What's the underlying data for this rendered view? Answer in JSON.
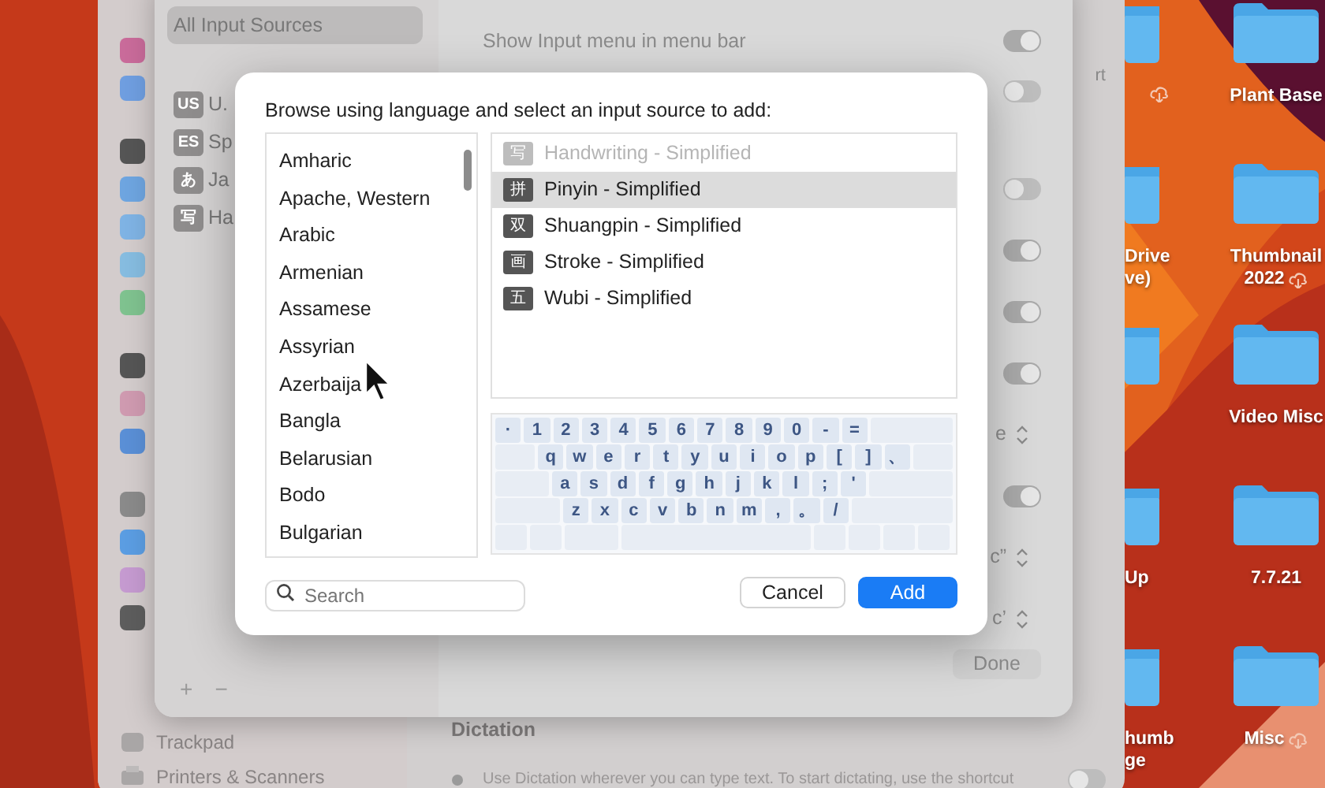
{
  "desktop": {
    "folder_columns": [
      {
        "folders": [
          {
            "cloud": true
          },
          {
            "label_lines": [
              "Drive",
              "ve)"
            ],
            "cloud": false
          },
          {
            "cloud": false
          },
          {
            "label_lines": [
              "Up"
            ],
            "cloud": false
          },
          {
            "label_lines": [
              "humb",
              "ge"
            ],
            "cloud": false
          }
        ]
      },
      {
        "folders": [
          {
            "label_lines": [
              "Plant Base"
            ],
            "cloud": false
          },
          {
            "label_lines": [
              "Thumbnail",
              "2022"
            ],
            "cloud": true
          },
          {
            "label_lines": [
              "Video Misc"
            ],
            "cloud": false
          },
          {
            "label_lines": [
              "7.7.21"
            ],
            "cloud": false
          },
          {
            "label_lines": [
              "Misc"
            ],
            "cloud": true
          }
        ]
      }
    ]
  },
  "settings_window": {
    "edge_text": "rt",
    "sidebar": {
      "items": [
        {
          "label": "Trackpad"
        },
        {
          "label": "Printers & Scanners"
        }
      ]
    },
    "dictation": {
      "heading": "Dictation",
      "description": "Use Dictation wherever you can type text. To start dictating, use the shortcut",
      "on": false
    },
    "input_sources_sheet": {
      "sources": [
        {
          "label": "All Input Sources",
          "selected": true
        },
        {
          "badge": "US",
          "label": "U.",
          "selected": false
        },
        {
          "badge": "ES",
          "label": "Sp",
          "selected": false
        },
        {
          "badge": "あ",
          "label": "Ja",
          "selected": false
        },
        {
          "badge": "写",
          "label": "Ha",
          "selected": false
        }
      ],
      "add_button": "+",
      "remove_button": "−",
      "settings": [
        {
          "kind": "toggle",
          "label": "Show Input menu in menu bar",
          "on": true
        },
        {
          "kind": "toggle",
          "on": false
        },
        {
          "kind": "toggle",
          "on": false
        },
        {
          "kind": "toggle",
          "on": true
        },
        {
          "kind": "toggle",
          "on": true
        },
        {
          "kind": "toggle",
          "on": true
        },
        {
          "kind": "popup",
          "value": "e"
        },
        {
          "kind": "toggle",
          "on": true
        },
        {
          "kind": "popup",
          "value": "c”"
        },
        {
          "kind": "popup",
          "value": "c’"
        }
      ],
      "done_button": "Done"
    }
  },
  "dialog": {
    "title": "Browse using language and select an input source to add:",
    "languages": [
      "Amharic",
      "Apache, Western",
      "Arabic",
      "Armenian",
      "Assamese",
      "Assyrian",
      "Azerbaija",
      "Bangla",
      "Belarusian",
      "Bodo",
      "Bulgarian"
    ],
    "input_sources": [
      {
        "badge": "写",
        "label": "Handwriting - Simplified",
        "disabled": true,
        "selected": false
      },
      {
        "badge": "拼",
        "label": "Pinyin - Simplified",
        "disabled": false,
        "selected": true
      },
      {
        "badge": "双",
        "label": "Shuangpin - Simplified",
        "disabled": false,
        "selected": false
      },
      {
        "badge": "画",
        "label": "Stroke - Simplified",
        "disabled": false,
        "selected": false
      },
      {
        "badge": "五",
        "label": "Wubi - Simplified",
        "disabled": false,
        "selected": false
      }
    ],
    "keyboard_rows": [
      [
        "·",
        "1",
        "2",
        "3",
        "4",
        "5",
        "6",
        "7",
        "8",
        "9",
        "0",
        "-",
        "="
      ],
      [
        "q",
        "w",
        "e",
        "r",
        "t",
        "y",
        "u",
        "i",
        "o",
        "p",
        "[",
        "]",
        "、"
      ],
      [
        "a",
        "s",
        "d",
        "f",
        "g",
        "h",
        "j",
        "k",
        "l",
        ";",
        "'"
      ],
      [
        "z",
        "x",
        "c",
        "v",
        "b",
        "n",
        "m",
        ",",
        "。",
        "/"
      ]
    ],
    "search": {
      "placeholder": "Search"
    },
    "cancel_button": "Cancel",
    "add_button": "Add"
  }
}
